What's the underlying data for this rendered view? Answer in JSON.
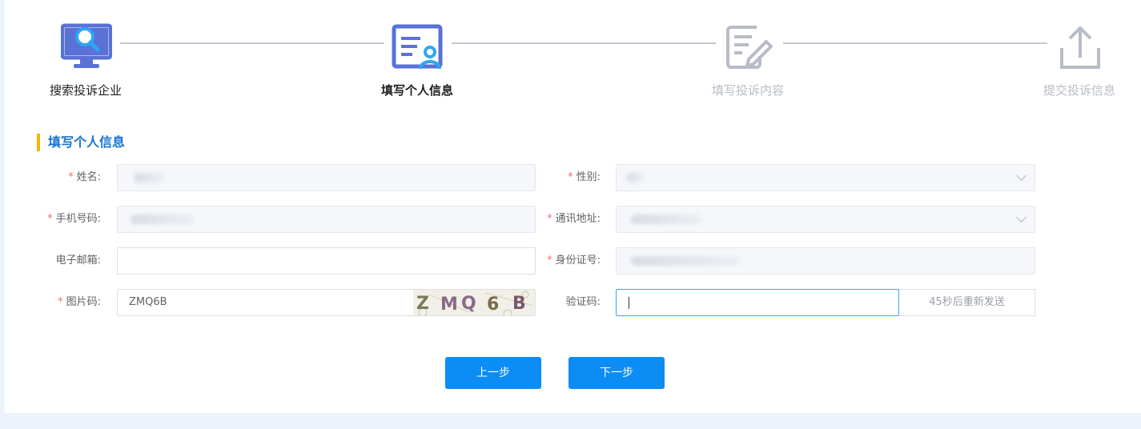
{
  "steps": [
    {
      "label": "搜索投诉企业",
      "state": "done",
      "icon": "search-monitor-icon"
    },
    {
      "label": "填写个人信息",
      "state": "active",
      "icon": "profile-card-icon"
    },
    {
      "label": "填写投诉内容",
      "state": "todo",
      "icon": "edit-document-icon"
    },
    {
      "label": "提交投诉信息",
      "state": "todo",
      "icon": "upload-icon"
    }
  ],
  "section": {
    "title": "填写个人信息"
  },
  "form": {
    "name": {
      "label": "姓名:",
      "required": true
    },
    "gender": {
      "label": "性别:",
      "required": true
    },
    "phone": {
      "label": "手机号码:",
      "required": true
    },
    "address": {
      "label": "通讯地址:",
      "required": true
    },
    "email": {
      "label": "电子邮箱:",
      "required": false,
      "value": ""
    },
    "id_number": {
      "label": "身份证号:",
      "required": true
    },
    "captcha": {
      "label": "图片码:",
      "required": true,
      "value": "ZMQ6B",
      "image_text": "ZMQ6B"
    },
    "verify_code": {
      "label": "验证码:",
      "required": false,
      "value": "",
      "send_label": "45秒后重新发送"
    }
  },
  "buttons": {
    "prev": "上一步",
    "next": "下一步"
  },
  "colors": {
    "primary": "#0c8cf5",
    "active_icon": "#5a72d6",
    "accent_icon": "#2fa6f2",
    "section_title": "#1673d1",
    "section_bar": "#f2b705",
    "inactive": "#b7bcc6"
  }
}
